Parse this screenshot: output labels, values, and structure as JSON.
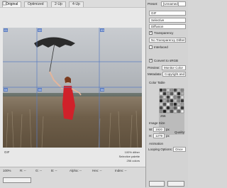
{
  "tabs": [
    {
      "label": "Original"
    },
    {
      "label": "Optimized"
    },
    {
      "label": "2-Up"
    },
    {
      "label": "4-Up"
    }
  ],
  "status": {
    "format": "GIF",
    "size_line": "",
    "zoom": "100%",
    "info_right_1": "100% dither",
    "info_right_2": "Selective palette",
    "info_right_3": "256 colors",
    "alpha": "Alpha: --",
    "hex": "Hex: --",
    "index": "Index: --",
    "r": "R: --",
    "g": "G: --",
    "b": "B: --"
  },
  "panel": {
    "preset_label": "Preset:",
    "preset_value": "[Unnamed]",
    "format_value": "GIF",
    "reduction_value": "Selective",
    "dither_value": "Diffusion",
    "transparency_label": "Transparency",
    "transparency_checked": true,
    "transparency_dither_value": "No Transparency Dither",
    "interlaced_label": "Interlaced",
    "interlaced_checked": false,
    "convert_srgb_label": "Convert to sRGB",
    "convert_srgb_checked": true,
    "preview_label": "Preview:",
    "preview_value": "Monitor Color",
    "metadata_label": "Metadata:",
    "metadata_value": "Copyright and Contact Info",
    "color_table_label": "Color Table",
    "color_count": "256",
    "image_size_label": "Image Size",
    "width_label": "W:",
    "width_value": "1920",
    "height_label": "H:",
    "height_value": "1279",
    "px_unit": "px",
    "quality_label": "Quality:",
    "animation_label": "Animation",
    "looping_label": "Looping Options:",
    "looping_value": "Once"
  },
  "slices": [
    {
      "label": "01"
    },
    {
      "label": "02"
    },
    {
      "label": "03"
    },
    {
      "label": "04"
    },
    {
      "label": "05"
    },
    {
      "label": "06"
    }
  ],
  "colors": {
    "slice_line": "#5a7cc2",
    "dress": "#d0212a",
    "umbrella": "#2b2b2b"
  }
}
